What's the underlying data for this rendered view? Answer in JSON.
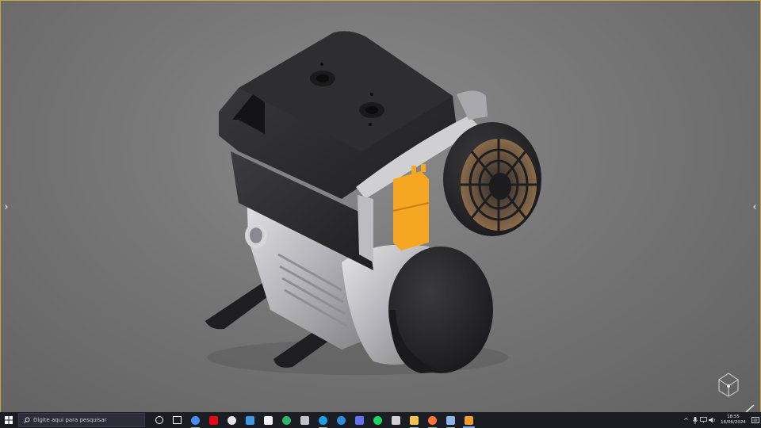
{
  "viewport": {
    "background": "#767676",
    "nav_left_glyph": "›",
    "nav_right_glyph": "‹"
  },
  "model": {
    "accent_color": "#f5a623",
    "body_dark": "#2c2c2e",
    "body_silver": "#b9b9bc"
  },
  "taskbar": {
    "search": {
      "placeholder": "Digite aqui para pesquisar"
    },
    "apps": [
      {
        "name": "cortana",
        "icon": "circle-icon",
        "color": "#ffffff"
      },
      {
        "name": "task-view",
        "icon": "task-view-icon",
        "color": "#ffffff"
      },
      {
        "name": "chrome",
        "icon": "chrome-icon",
        "color": "#4a8af4"
      },
      {
        "name": "netflix",
        "icon": "netflix-icon",
        "color": "#e50914"
      },
      {
        "name": "xbox",
        "icon": "xbox-icon",
        "color": "#e6e6e6"
      },
      {
        "name": "vscode",
        "icon": "code-icon",
        "color": "#3b9ae1"
      },
      {
        "name": "store",
        "icon": "store-icon",
        "color": "#f3f3f3"
      },
      {
        "name": "headset",
        "icon": "headset-icon",
        "color": "#2fb56a"
      },
      {
        "name": "usb-tool",
        "icon": "usb-icon",
        "color": "#bfc4cc"
      },
      {
        "name": "skype",
        "icon": "skype-icon",
        "color": "#1f9ee8"
      },
      {
        "name": "edge",
        "icon": "edge-icon",
        "color": "#2d8fdc"
      },
      {
        "name": "discord",
        "icon": "discord-icon",
        "color": "#6570f0"
      },
      {
        "name": "spotify",
        "icon": "spotify-icon",
        "color": "#1ed760"
      },
      {
        "name": "terminal",
        "icon": "terminal-icon",
        "color": "#d0d0d0"
      },
      {
        "name": "explorer",
        "icon": "folder-icon",
        "color": "#f2c14e"
      },
      {
        "name": "firefox",
        "icon": "firefox-icon",
        "color": "#ff7139"
      },
      {
        "name": "photos",
        "icon": "photos-icon",
        "color": "#8fb4e8"
      },
      {
        "name": "fusion",
        "icon": "fusion-icon",
        "color": "#f29b30"
      }
    ],
    "tray": {
      "chevron": "^",
      "clock_time": "18:55",
      "clock_date": "16/06/2024"
    }
  }
}
